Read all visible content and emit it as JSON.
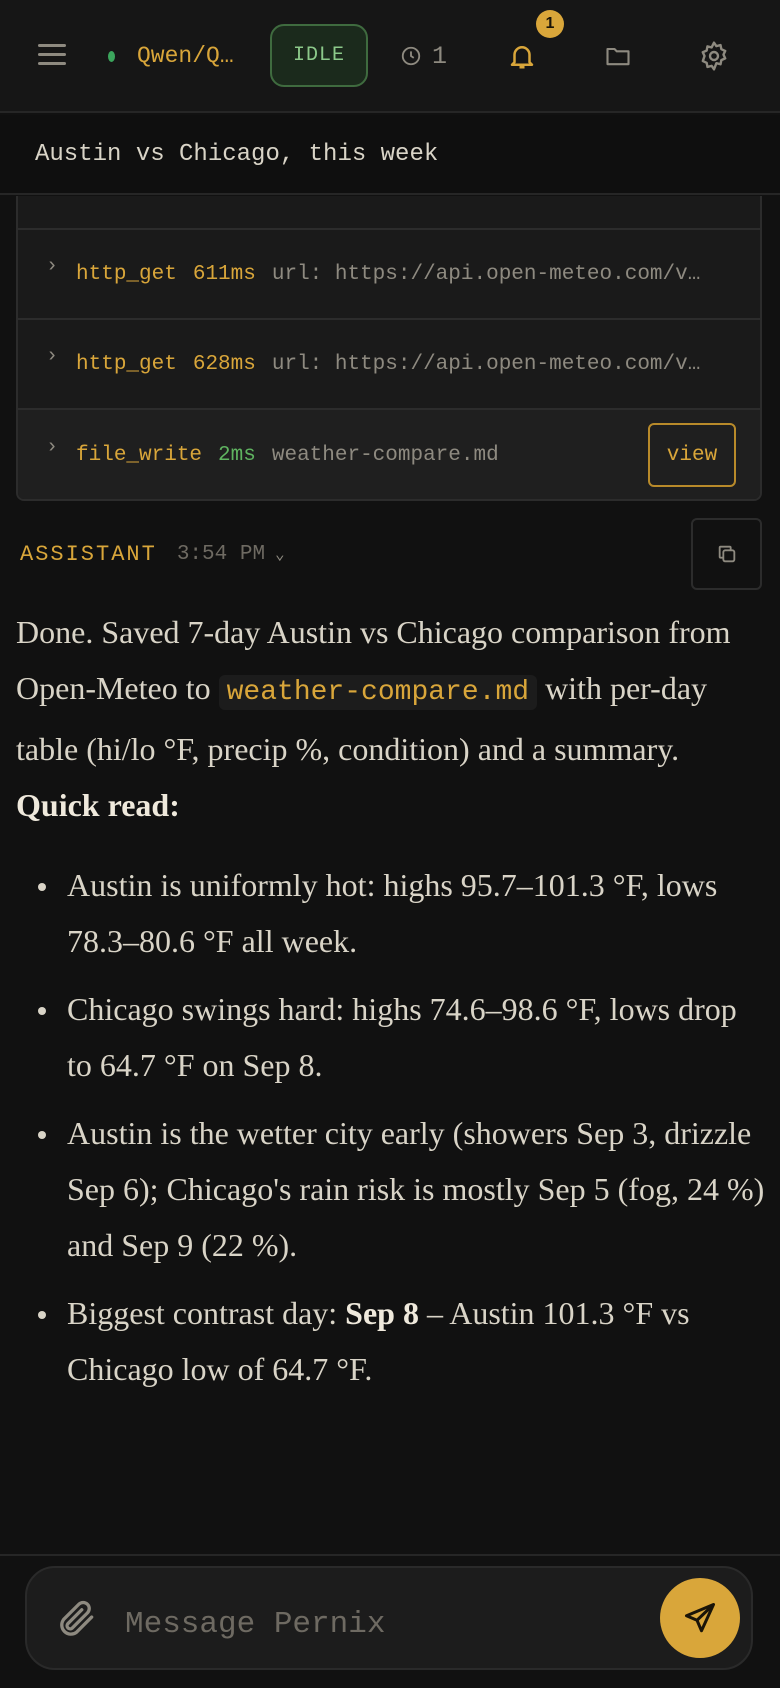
{
  "header": {
    "model_name": "Qwen/Q…",
    "status": "IDLE",
    "history_count": "1",
    "notification_count": "1"
  },
  "conversation": {
    "title": "Austin vs Chicago, this week"
  },
  "tool_calls": [
    {
      "name": "http_get",
      "duration": "611ms",
      "args": "url: https://api.open-meteo.com/v…"
    },
    {
      "name": "http_get",
      "duration": "628ms",
      "args": "url: https://api.open-meteo.com/v…"
    },
    {
      "name": "file_write",
      "duration": "2ms",
      "args": "weather-compare.md",
      "action": "view"
    }
  ],
  "message": {
    "role": "ASSISTANT",
    "time": "3:54 PM",
    "intro_before": "Done. Saved 7-day Austin vs Chicago comparison from Open-Meteo to ",
    "intro_code": "weather-compare.md",
    "intro_after": " with per-day table (hi/lo °F, precip %, condition) and a summary.",
    "heading": "Quick read:",
    "bullets": [
      "Austin is uniformly hot: highs 95.7–101.3 °F, lows 78.3–80.6 °F all week.",
      "Chicago swings hard: highs 74.6–98.6 °F, lows drop to 64.7 °F on Sep 8.",
      "Austin is the wetter city early (showers Sep 3, drizzle Sep 6); Chicago's rain risk is mostly Sep 5 (fog, 24 %) and Sep 9 (22 %)."
    ],
    "last_bullet_before": "Biggest contrast day: ",
    "last_bullet_bold": "Sep 8",
    "last_bullet_after": " – Austin 101.3 °F vs Chicago low of 64.7 °F."
  },
  "composer": {
    "placeholder": "Message Pernix"
  },
  "colors": {
    "accent": "#d9a63a",
    "idle_green": "#8cc98a",
    "success_green": "#5fb360",
    "background": "#111111"
  },
  "icons": {
    "menu": "hamburger-icon",
    "model_status": "green-dot-icon",
    "history": "clock-icon",
    "notifications": "bell-icon",
    "files": "folder-icon",
    "settings": "gear-icon",
    "expand": "chevron-right-icon",
    "copy": "copy-icon",
    "attach": "paperclip-icon",
    "send": "paper-plane-icon"
  }
}
